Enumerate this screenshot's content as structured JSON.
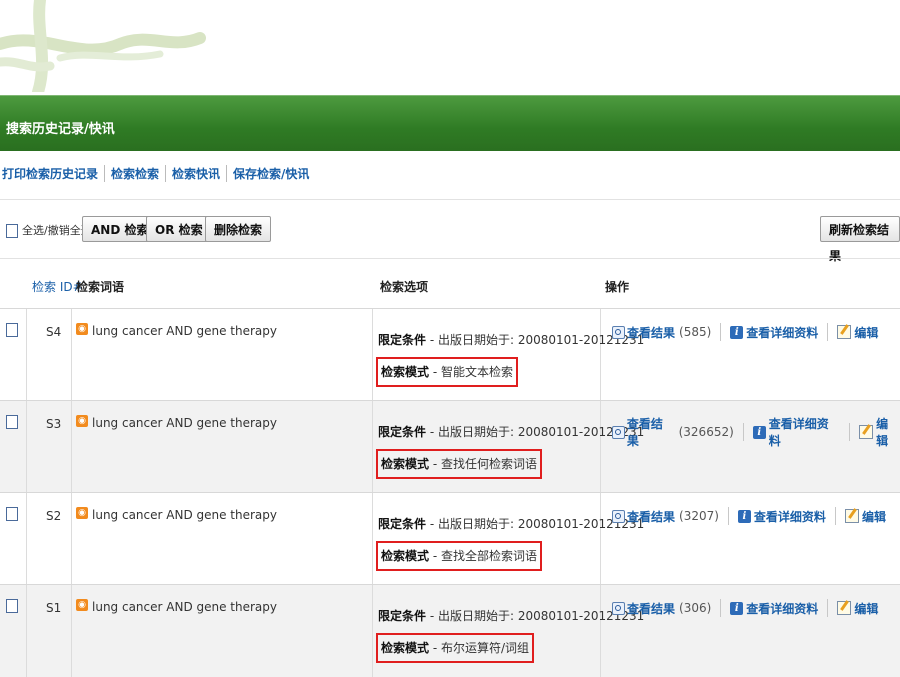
{
  "header": {
    "title": "搜索历史记录/快讯"
  },
  "links": [
    "打印检索历史记录",
    "检索检索",
    "检索快讯",
    "保存检索/快讯"
  ],
  "toolbar": {
    "select_all_label": "全选/撤销全选",
    "and_label": "AND 检索",
    "or_label": "OR 检索",
    "delete_label": "删除检索",
    "refresh_label": "刷新检索结果"
  },
  "table": {
    "headers": {
      "id": "检索 ID#",
      "terms": "检索词语",
      "options": "检索选项",
      "actions": "操作"
    },
    "rows": [
      {
        "id": "S4",
        "terms": "lung cancer AND gene therapy",
        "limit_label": "限定条件",
        "limit_value": " - 出版日期始于: 20080101-20121231",
        "mode_label": "检索模式",
        "mode_value": " - 智能文本检索",
        "results_label": "查看结果",
        "count": "(585)",
        "details_label": "查看详细资料",
        "edit_label": "编辑"
      },
      {
        "id": "S3",
        "terms": "lung cancer AND gene therapy",
        "limit_label": "限定条件",
        "limit_value": " - 出版日期始于: 20080101-20121231",
        "mode_label": "检索模式",
        "mode_value": " - 查找任何检索词语",
        "results_label": "查看结果",
        "count": "(326652)",
        "details_label": "查看详细资料",
        "edit_label": "编辑"
      },
      {
        "id": "S2",
        "terms": "lung cancer AND gene therapy",
        "limit_label": "限定条件",
        "limit_value": " - 出版日期始于: 20080101-20121231",
        "mode_label": "检索模式",
        "mode_value": " - 查找全部检索词语",
        "results_label": "查看结果",
        "count": "(3207)",
        "details_label": "查看详细资料",
        "edit_label": "编辑"
      },
      {
        "id": "S1",
        "terms": "lung cancer AND gene therapy",
        "limit_label": "限定条件",
        "limit_value": " - 出版日期始于: 20080101-20121231",
        "mode_label": "检索模式",
        "mode_value": " - 布尔运算符/词组",
        "results_label": "查看结果",
        "count": "(306)",
        "details_label": "查看详细资料",
        "edit_label": "编辑"
      }
    ]
  },
  "colors": {
    "banner": "#3a8a2e",
    "link": "#1a5fa8",
    "highlight_border": "#e01e1e"
  },
  "icons": [
    "logo-vine-icon",
    "rss-icon",
    "magnifier-icon",
    "info-icon",
    "edit-icon"
  ]
}
